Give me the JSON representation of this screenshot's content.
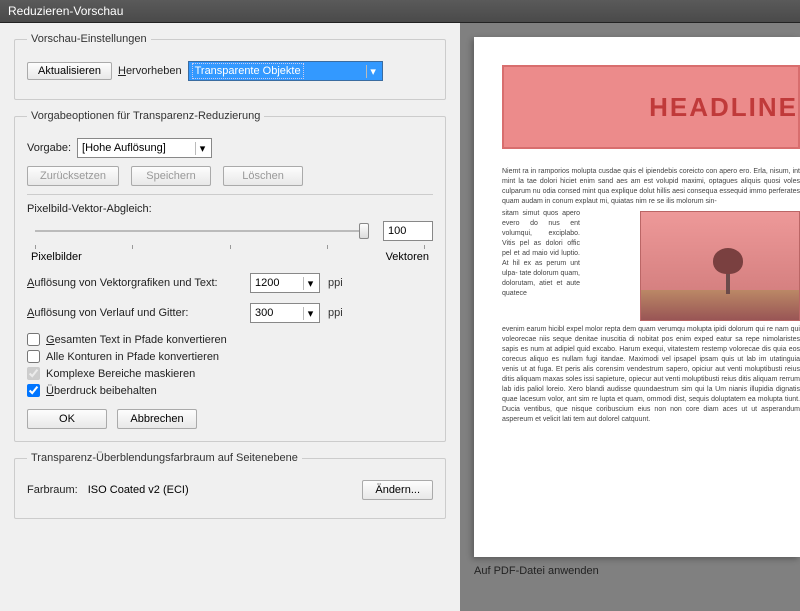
{
  "window": {
    "title": "Reduzieren-Vorschau"
  },
  "preview_settings": {
    "legend": "Vorschau-Einstellungen",
    "refresh": "Aktualisieren",
    "highlight_label": "Hervorheben",
    "highlight_value": "Transparente Objekte"
  },
  "preset_options": {
    "legend": "Vorgabeoptionen für Transparenz-Reduzierung",
    "preset_label": "Vorgabe:",
    "preset_value": "[Hohe Auflösung]",
    "reset": "Zurücksetzen",
    "save": "Speichern",
    "delete": "Löschen",
    "slider_label": "Pixelbild-Vektor-Abgleich:",
    "slider_value": "100",
    "slider_left": "Pixelbilder",
    "slider_right": "Vektoren",
    "vector_res_label": "Auflösung von Vektorgrafiken und Text:",
    "vector_res_value": "1200",
    "gradient_res_label": "Auflösung von Verlauf und Gitter:",
    "gradient_res_value": "300",
    "ppi": "ppi",
    "chk_text_paths": "Gesamten Text in Pfade konvertieren",
    "chk_all_strokes": "Alle Konturen in Pfade konvertieren",
    "chk_complex": "Komplexe Bereiche maskieren",
    "chk_overprint": "Überdruck beibehalten",
    "ok": "OK",
    "cancel": "Abbrechen"
  },
  "blend_space": {
    "legend": "Transparenz-Überblendungsfarbraum auf Seitenebene",
    "colorspace_label": "Farbraum:",
    "colorspace_value": "ISO Coated v2 (ECI)",
    "change": "Ändern..."
  },
  "preview": {
    "headline": "HEADLINE",
    "apply": "Auf PDF-Datei anwenden",
    "lorem_head": "Niemt ra in ramporios molupta cusdae quis el ipiendebis coreicto con apero ero. Erla, nisum, int mint la tae dolori hiciet enim sand aes am est volupid maximi, optagues aliquis quosi voles culparum nu odia consed mint qua explique dolut hillis aesi consequa essequid immo perferates quam audam in conum explaut mi, quiatas nim re se ilis molorum sin-",
    "lorem_left": "sitam simut quos apero evero do nus ent volumqui, exciplabo. Vitis pel as dolori offic pel et ad maio vid luptio. At hil ex as perum unt ulpa- tate dolorum quam, dolorutam, atiet et aute quatece",
    "lorem_rest": "evenim earum hicibl expel molor repta dem quam verumqu molupta ipidi dolorum qui re nam qui voleorecae niis seque denitae inuscitia di nobitat pos enim exped eatur sa repe nimolaristes sapis es num at adipiel quid excabo. Harum exequi, vitatestem restemp volorecae dis quia eos corecus aliquo es nullam fugi itandae. Maximodi vel ipsapel ipsam quis ut lab im utatinguia venis ut at fuga. Et peris alis corensim vendestrum sapero, opiciur aut venti moluptibusti reius ditis aliquam maxas soles issi sapieture, opiecur aut venti moluptibusti reius ditis aliquam rerrum lab idis paliol loreio. Xero blandi audisse quundaestrum sim qui la Um nianis illupidia dignatis quae lacesum volor, ant sim re lupta et quam, ommodi dist, sequis doluptatem ea molupta tiunt. Ducia ventibus, que nisque coribuscium eius non non core diam aces ut ut asperandum aspereum et velicit lati tem aut dolorel catquunt."
  }
}
